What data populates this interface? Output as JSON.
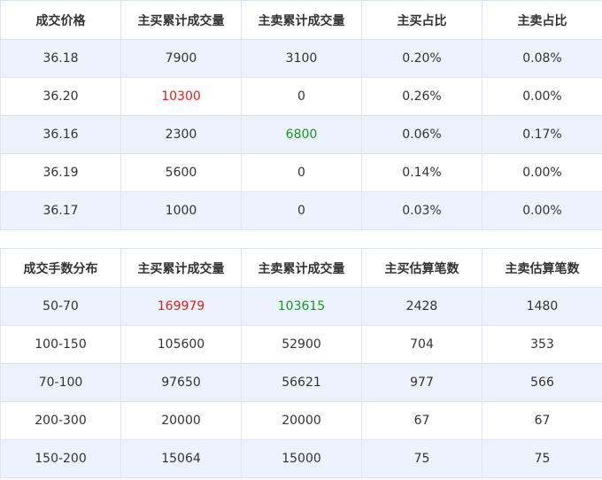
{
  "colors": {
    "red": "#e31b1b",
    "green": "#139a1d",
    "stripe": "#edf3fc",
    "border": "#dbe4f1"
  },
  "price_table": {
    "headers": [
      "成交价格",
      "主买累计成交量",
      "主卖累计成交量",
      "主买占比",
      "主卖占比"
    ],
    "rows": [
      {
        "cells": [
          "36.18",
          "7900",
          "3100",
          "0.20%",
          "0.08%"
        ],
        "highlight": {}
      },
      {
        "cells": [
          "36.20",
          "10300",
          "0",
          "0.26%",
          "0.00%"
        ],
        "highlight": {
          "1": "red"
        }
      },
      {
        "cells": [
          "36.16",
          "2300",
          "6800",
          "0.06%",
          "0.17%"
        ],
        "highlight": {
          "2": "green"
        }
      },
      {
        "cells": [
          "36.19",
          "5600",
          "0",
          "0.14%",
          "0.00%"
        ],
        "highlight": {}
      },
      {
        "cells": [
          "36.17",
          "1000",
          "0",
          "0.03%",
          "0.00%"
        ],
        "highlight": {}
      }
    ]
  },
  "lot_table": {
    "headers": [
      "成交手数分布",
      "主买累计成交量",
      "主卖累计成交量",
      "主买估算笔数",
      "主卖估算笔数"
    ],
    "rows": [
      {
        "cells": [
          "50-70",
          "169979",
          "103615",
          "2428",
          "1480"
        ],
        "highlight": {
          "1": "red",
          "2": "green"
        }
      },
      {
        "cells": [
          "100-150",
          "105600",
          "52900",
          "704",
          "353"
        ],
        "highlight": {}
      },
      {
        "cells": [
          "70-100",
          "97650",
          "56621",
          "977",
          "566"
        ],
        "highlight": {}
      },
      {
        "cells": [
          "200-300",
          "20000",
          "20000",
          "67",
          "67"
        ],
        "highlight": {}
      },
      {
        "cells": [
          "150-200",
          "15064",
          "15000",
          "75",
          "75"
        ],
        "highlight": {}
      }
    ]
  }
}
